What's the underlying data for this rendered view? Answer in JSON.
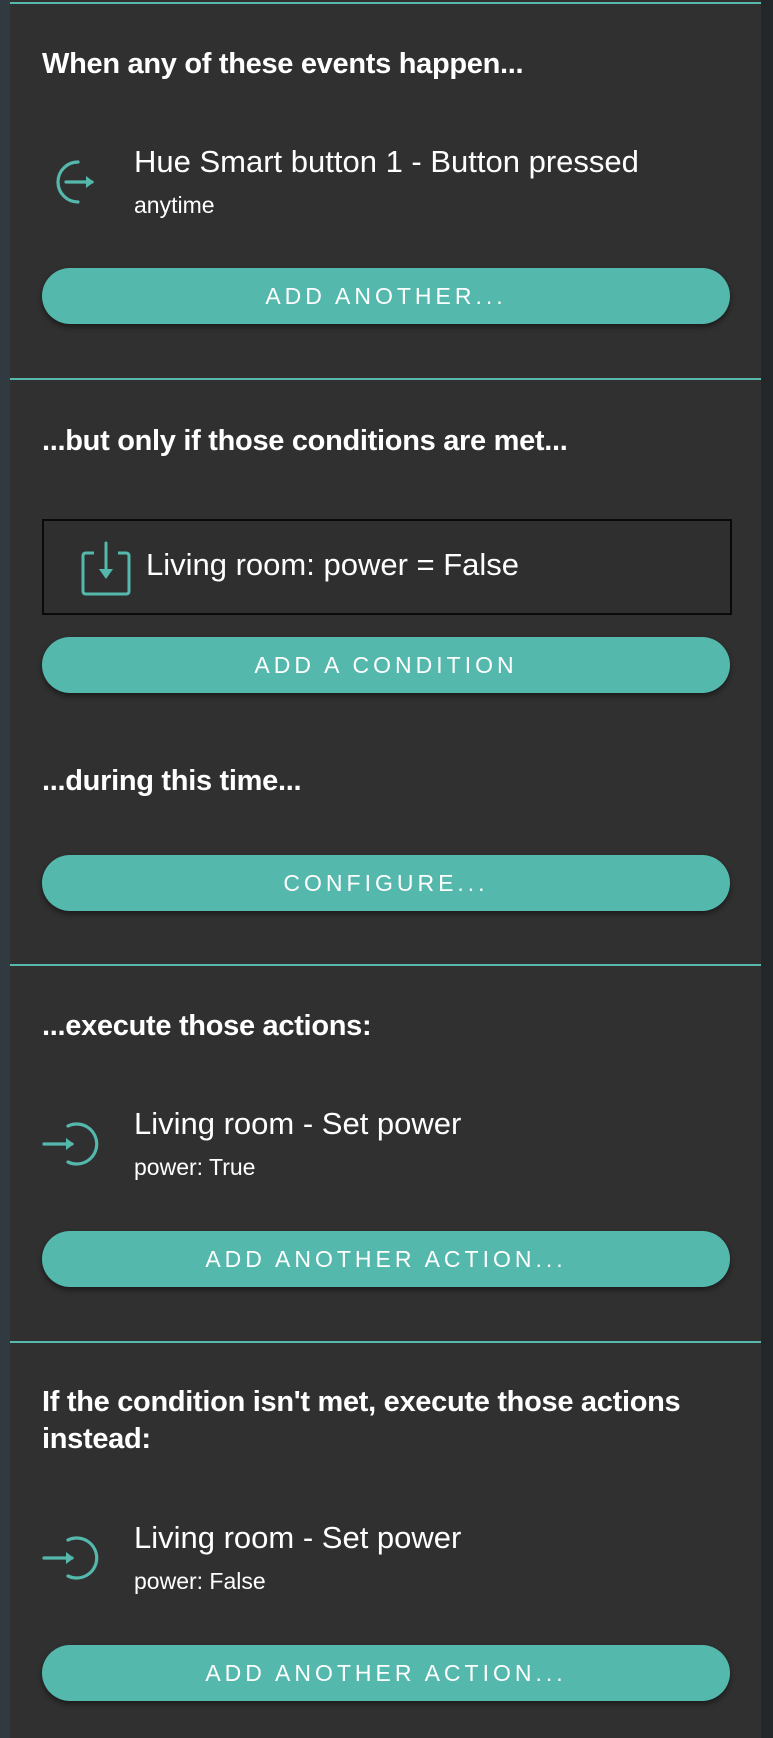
{
  "events": {
    "heading": "When any of these events happen...",
    "items": [
      {
        "icon": "event-exit-icon",
        "title": "Hue Smart button 1 - Button pressed",
        "subtitle": "anytime"
      }
    ],
    "add_button": "ADD ANOTHER..."
  },
  "conditions": {
    "heading": "...but only if those conditions are met...",
    "items": [
      {
        "icon": "condition-download-icon",
        "label": "Living room: power = False"
      }
    ],
    "add_button": "ADD A CONDITION"
  },
  "time": {
    "heading": "...during this time...",
    "configure_button": "CONFIGURE..."
  },
  "actions": {
    "heading": "...execute those actions:",
    "items": [
      {
        "icon": "action-enter-icon",
        "title": "Living room - Set power",
        "subtitle": "power: True"
      }
    ],
    "add_button": "ADD ANOTHER ACTION..."
  },
  "else_actions": {
    "heading": "If the condition isn't met, execute those actions instead:",
    "items": [
      {
        "icon": "action-enter-icon",
        "title": "Living room - Set power",
        "subtitle": "power: False"
      }
    ],
    "add_button": "ADD ANOTHER ACTION..."
  },
  "colors": {
    "accent": "#54b8ad",
    "panel": "#303030",
    "text": "#ffffff"
  }
}
